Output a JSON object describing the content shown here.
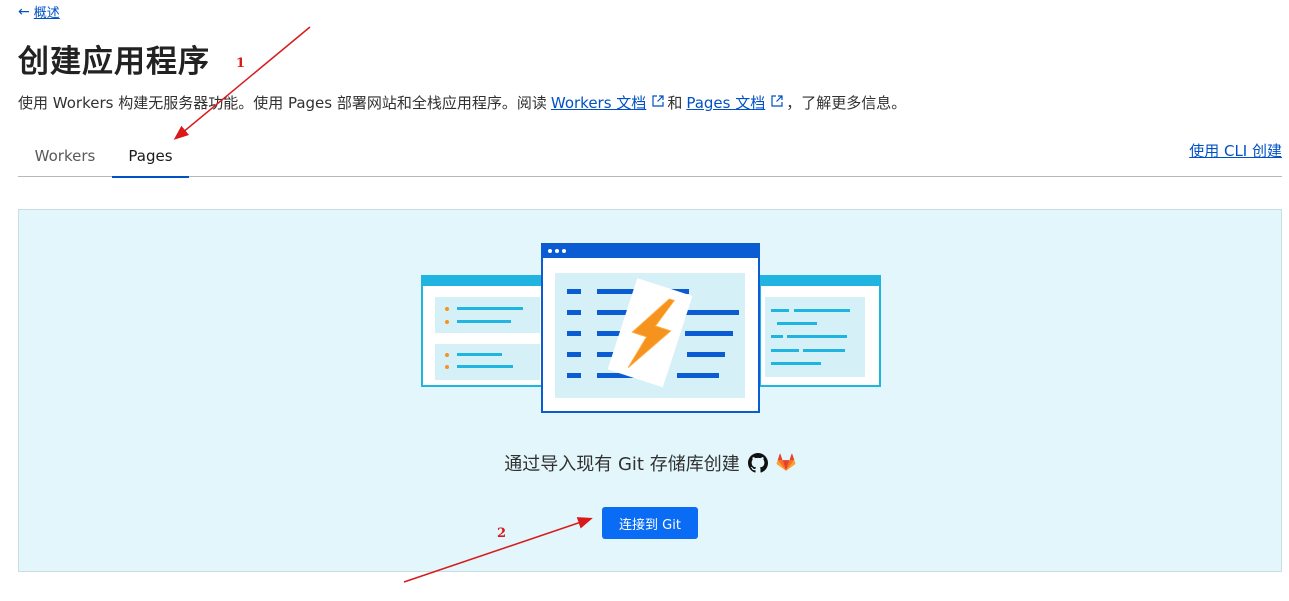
{
  "nav": {
    "back_label": "概述"
  },
  "page": {
    "title": "创建应用程序",
    "description_prefix": "使用 Workers 构建无服务器功能。使用 Pages 部署网站和全栈应用程序。阅读",
    "workers_docs_link": "Workers 文档",
    "join_text": "和",
    "pages_docs_link": "Pages 文档",
    "description_suffix": "，了解更多信息。"
  },
  "tabs": [
    {
      "label": "Workers",
      "active": false
    },
    {
      "label": "Pages",
      "active": true
    }
  ],
  "cli_link": "使用 CLI 创建",
  "panel": {
    "cta_text": "通过导入现有 Git 存储库创建",
    "connect_button": "连接到 Git",
    "icons": [
      "github-icon",
      "gitlab-icon"
    ]
  },
  "annotations": [
    {
      "label": "1"
    },
    {
      "label": "2"
    }
  ],
  "colors": {
    "link": "#0051c3",
    "accent": "#0a6cf5",
    "panel_bg": "#e3f6fb",
    "annotation": "#d81a1a"
  }
}
